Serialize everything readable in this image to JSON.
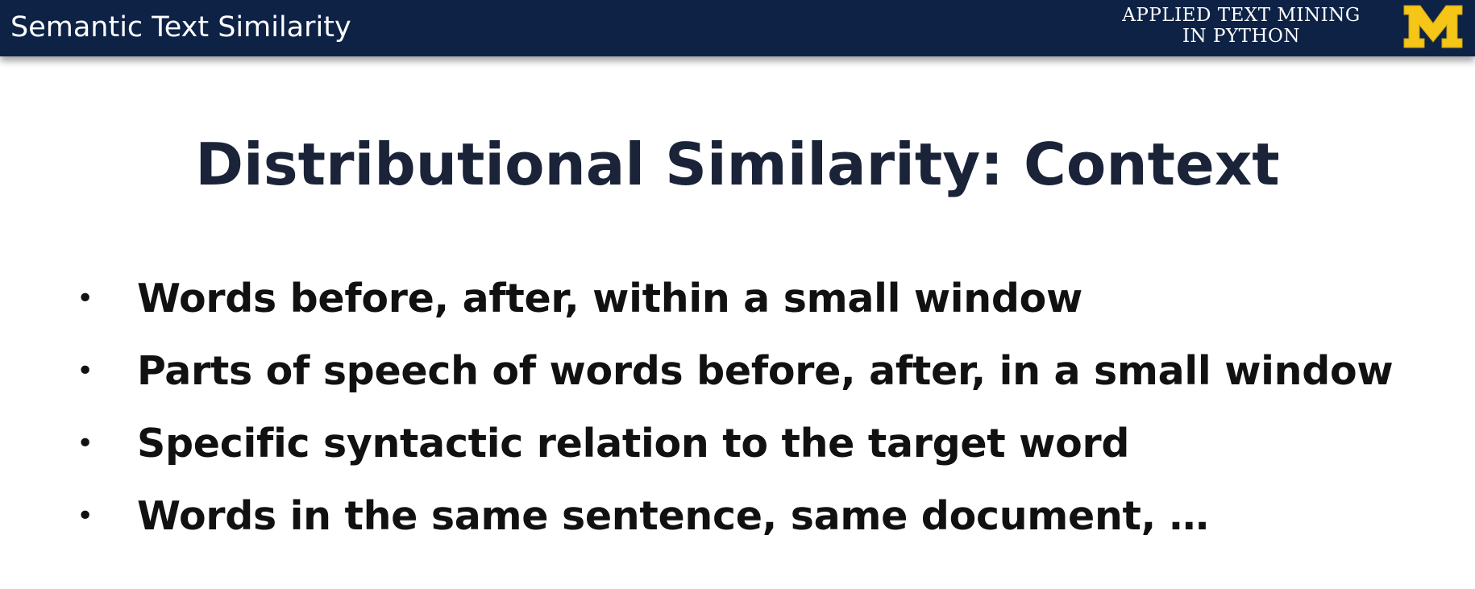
{
  "header": {
    "section_title": "Semantic Text Similarity",
    "course_line1": "APPLIED TEXT MINING",
    "course_line2": "IN PYTHON",
    "logo_icon": "block-m-logo-icon",
    "colors": {
      "bar": "#0d2245",
      "logo": "#f5c518"
    }
  },
  "slide": {
    "title": "Distributional Similarity: Context",
    "bullets": [
      "Words before, after, within a small window",
      "Parts of speech of words before, after, in a small window",
      "Specific syntactic relation to the target word",
      "Words in the same sentence, same document, …"
    ]
  }
}
